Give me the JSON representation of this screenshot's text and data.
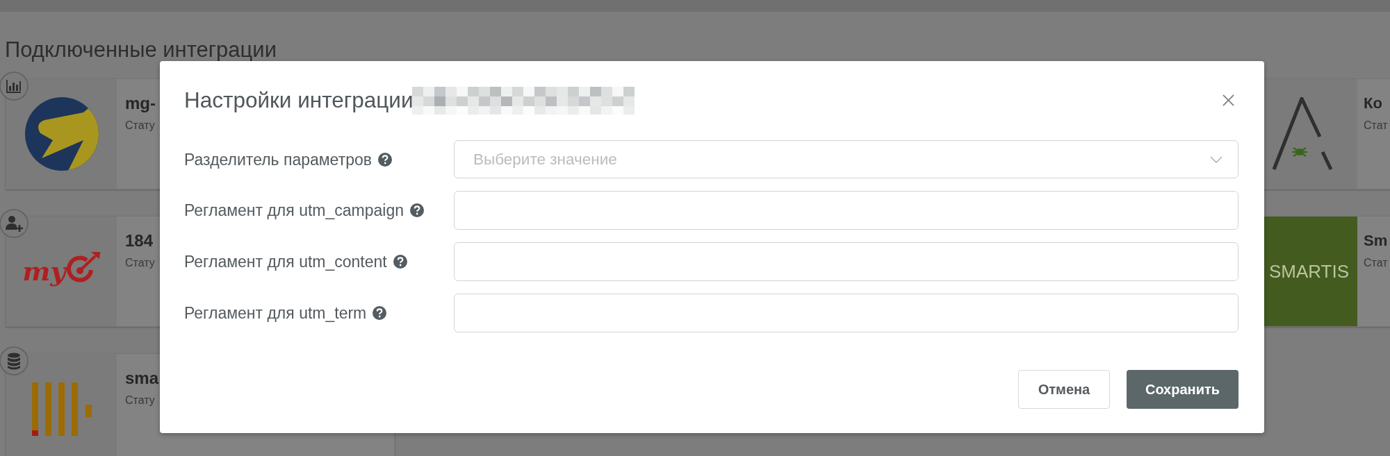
{
  "page": {
    "heading": "Подключенные интеграции"
  },
  "integrations": {
    "left": [
      {
        "badge": {
          "kind": "chart"
        },
        "logo": {
          "kind": "arrow-circle"
        },
        "title": "mg-",
        "status": "Стату"
      },
      {
        "badge": {
          "kind": "user-plus"
        },
        "logo": {
          "kind": "my-target",
          "text": "my"
        },
        "title": "184",
        "status": "Стату"
      },
      {
        "badge": {
          "kind": "database"
        },
        "logo": {
          "kind": "bars"
        },
        "title": "sma",
        "status": "Стату"
      }
    ],
    "right": [
      {
        "logo": {
          "kind": "peak-bug"
        },
        "title": "Ко",
        "status": "Стат"
      },
      {
        "logo": {
          "kind": "wordmark",
          "text": "SMARTIS"
        },
        "title": "Sm",
        "status": "Стат"
      }
    ]
  },
  "dialog": {
    "title": "Настройки интеграции",
    "title_redacted": true,
    "fields": [
      {
        "kind": "select",
        "label": "Разделитель параметров",
        "help": true,
        "placeholder": "Выберите значение"
      },
      {
        "kind": "text",
        "label": "Регламент для utm_campaign",
        "help": true
      },
      {
        "kind": "text",
        "label": "Регламент для utm_content",
        "help": true
      },
      {
        "kind": "text",
        "label": "Регламент для utm_term",
        "help": true
      }
    ],
    "buttons": [
      {
        "kind": "secondary",
        "label": "Отмена"
      },
      {
        "kind": "primary",
        "label": "Сохранить"
      }
    ]
  }
}
